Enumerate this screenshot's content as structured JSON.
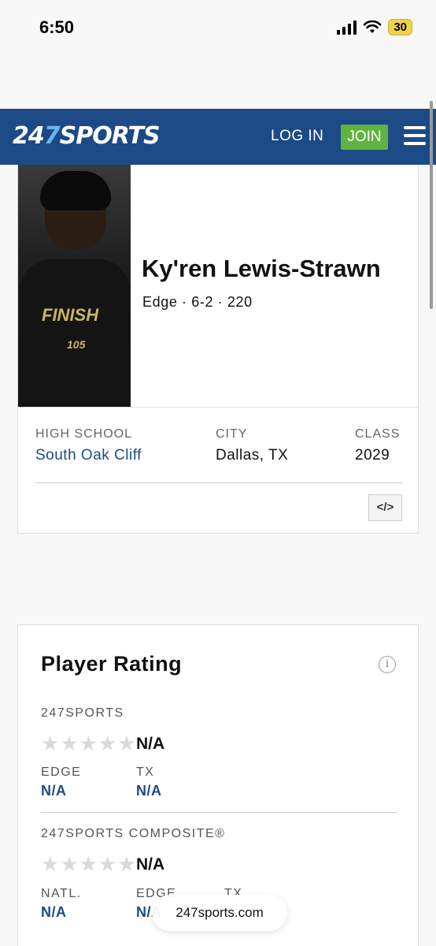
{
  "status": {
    "time": "6:50",
    "battery": "30"
  },
  "nav": {
    "logo_num": "24",
    "logo_seven": "7",
    "logo_text": "SPORTS",
    "login": "LOG IN",
    "join": "JOIN"
  },
  "player": {
    "name": "Ky'ren Lewis-Strawn",
    "meta": "Edge · 6-2 · 220",
    "photo_text": "FINISH",
    "photo_number": "105",
    "high_school_label": "HIGH SCHOOL",
    "high_school": "South Oak Cliff",
    "city_label": "CITY",
    "city": "Dallas, TX",
    "class_label": "CLASS",
    "class": "2029",
    "embed": "</>"
  },
  "rating": {
    "title": "Player Rating",
    "info": "i",
    "sports247": {
      "label": "247SPORTS",
      "stars": 0,
      "rating": "N/A",
      "rank1_label": "EDGE",
      "rank1_value": "N/A",
      "rank2_label": "TX",
      "rank2_value": "N/A"
    },
    "composite": {
      "label": "247SPORTS COMPOSITE®",
      "stars": 0,
      "rating": "N/A",
      "rank1_label": "NATL.",
      "rank1_value": "N/A",
      "rank2_label": "EDGE",
      "rank2_value": "N/A",
      "rank3_label": "TX"
    }
  },
  "browser": {
    "url": "247sports.com"
  },
  "colors": {
    "brand_blue": "#1c4a86",
    "join_green": "#5fb43f",
    "star_empty": "#d9d9d9"
  }
}
